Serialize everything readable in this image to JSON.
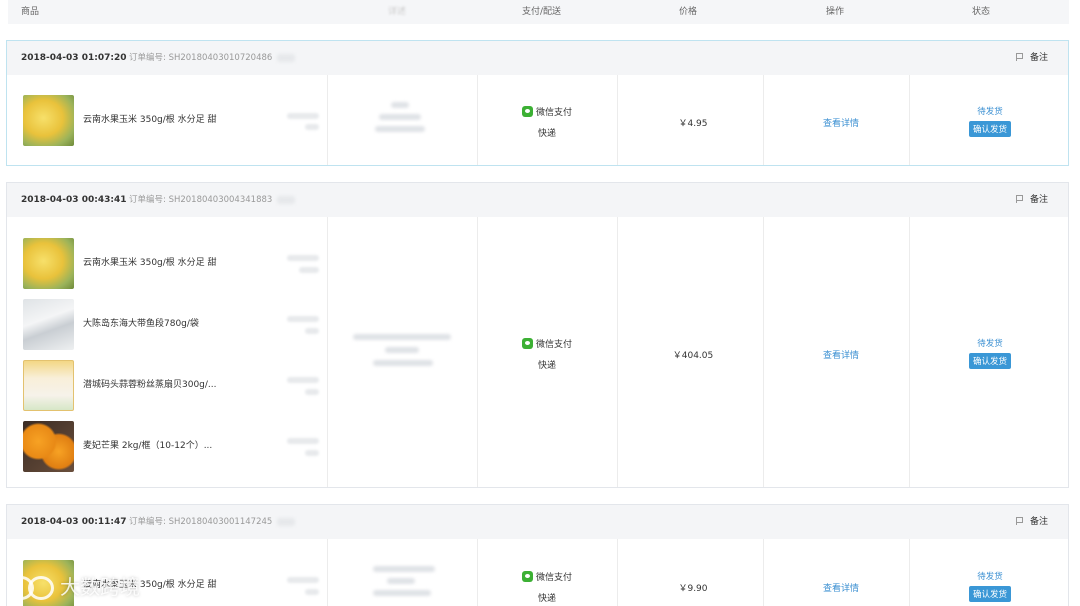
{
  "columns": [
    "商品",
    "详述",
    "支付/配送",
    "价格",
    "操作",
    "状态"
  ],
  "orders": [
    {
      "date": "2018-04-03  01:07:20",
      "order_no": "订单编号: SH20180403010720486",
      "note_label": "备注",
      "items": [
        {
          "name": "云南水果玉米 350g/根 水分足 甜",
          "thumb": "corn-thumbnail"
        }
      ],
      "payment": "微信支付",
      "shipping": "快递",
      "price": "￥4.95",
      "action": "查看详情",
      "status": "待发货",
      "confirm": "确认发货"
    },
    {
      "date": "2018-04-03  00:43:41",
      "order_no": "订单编号: SH20180403004341883",
      "note_label": "备注",
      "items": [
        {
          "name": "云南水果玉米 350g/根 水分足 甜",
          "thumb": "corn-thumbnail"
        },
        {
          "name": "大陈岛东海大带鱼段780g/袋",
          "thumb": "fish-thumbnail"
        },
        {
          "name": "潜城码头蒜蓉粉丝蒸扇贝300g/...",
          "thumb": "scallop-thumbnail"
        },
        {
          "name": "麦妃芒果 2kg/框（10-12个）...",
          "thumb": "mango-thumbnail"
        }
      ],
      "payment": "微信支付",
      "shipping": "快递",
      "price": "￥404.05",
      "action": "查看详情",
      "status": "待发货",
      "confirm": "确认发货"
    },
    {
      "date": "2018-04-03  00:11:47",
      "order_no": "订单编号: SH20180403001147245",
      "note_label": "备注",
      "items": [
        {
          "name": "云南水果玉米 350g/根 水分足 甜",
          "thumb": "corn-thumbnail"
        }
      ],
      "payment": "微信支付",
      "shipping": "快递",
      "price": "￥9.90",
      "action": "查看详情",
      "status": "待发货",
      "confirm": "确认发货"
    }
  ],
  "watermark": "大数跨境",
  "colors": {
    "link": "#3a8fd2",
    "button": "#3a97d6",
    "wechat": "#3cb034",
    "header_bg": "#f5f6f8"
  }
}
